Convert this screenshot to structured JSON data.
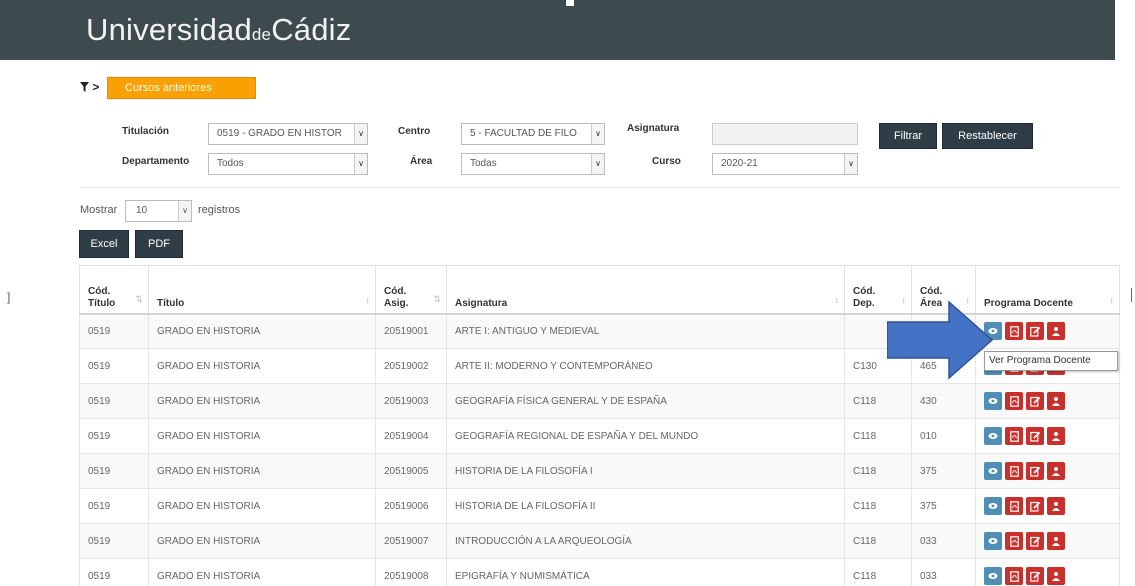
{
  "header": {
    "logo_left": "Universidad",
    "logo_de": "de",
    "logo_right": "Cádiz"
  },
  "filters": {
    "toggle_icon": "filter-icon",
    "arrow": ">",
    "cursos_anteriores": "Cursos anteriores",
    "titulacion_label": "Titulación",
    "titulacion_value": "0519 - GRADO EN HISTOR",
    "centro_label": "Centro",
    "centro_value": "5 - FACULTAD DE FILO",
    "asignatura_label": "Asignatura",
    "asignatura_value": "",
    "departamento_label": "Departamento",
    "departamento_value": "Todos",
    "area_label": "Área",
    "area_value": "Todas",
    "curso_label": "Curso",
    "curso_value": "2020-21",
    "filtrar": "Filtrar",
    "restablecer": "Restablecer"
  },
  "controls": {
    "mostrar": "Mostrar",
    "page_length": "10",
    "registros": "registros",
    "excel": "Excel",
    "pdf": "PDF"
  },
  "table": {
    "columns": [
      {
        "l1": "Cód.",
        "l2": "Título"
      },
      {
        "l1": "",
        "l2": "Título"
      },
      {
        "l1": "Cód.",
        "l2": "Asig."
      },
      {
        "l1": "",
        "l2": "Asignatura"
      },
      {
        "l1": "Cód.",
        "l2": "Dep."
      },
      {
        "l1": "Cód.",
        "l2": "Área"
      },
      {
        "l1": "",
        "l2": "Programa Docente"
      }
    ],
    "rows": [
      {
        "cod_titulo": "0519",
        "titulo": "GRADO EN HISTORIA",
        "cod_asig": "20519001",
        "asignatura": "ARTE I: ANTIGUO Y MEDIEVAL",
        "cod_dep": "",
        "cod_area": ""
      },
      {
        "cod_titulo": "0519",
        "titulo": "GRADO EN HISTORIA",
        "cod_asig": "20519002",
        "asignatura": "ARTE II: MODERNO Y CONTEMPORÁNEO",
        "cod_dep": "C130",
        "cod_area": "465"
      },
      {
        "cod_titulo": "0519",
        "titulo": "GRADO EN HISTORIA",
        "cod_asig": "20519003",
        "asignatura": "GEOGRAFÍA FÍSICA GENERAL Y DE ESPAÑA",
        "cod_dep": "C118",
        "cod_area": "430"
      },
      {
        "cod_titulo": "0519",
        "titulo": "GRADO EN HISTORIA",
        "cod_asig": "20519004",
        "asignatura": "GEOGRAFÍA REGIONAL DE ESPAÑA Y DEL MUNDO",
        "cod_dep": "C118",
        "cod_area": "010"
      },
      {
        "cod_titulo": "0519",
        "titulo": "GRADO EN HISTORIA",
        "cod_asig": "20519005",
        "asignatura": "HISTORIA DE LA FILOSOFÍA I",
        "cod_dep": "C118",
        "cod_area": "375"
      },
      {
        "cod_titulo": "0519",
        "titulo": "GRADO EN HISTORIA",
        "cod_asig": "20519006",
        "asignatura": "HISTORIA DE LA FILOSOFÍA II",
        "cod_dep": "C118",
        "cod_area": "375"
      },
      {
        "cod_titulo": "0519",
        "titulo": "GRADO EN HISTORIA",
        "cod_asig": "20519007",
        "asignatura": "INTRODUCCIÓN A LA ARQUEOLOGÍA",
        "cod_dep": "C118",
        "cod_area": "033"
      },
      {
        "cod_titulo": "0519",
        "titulo": "GRADO EN HISTORIA",
        "cod_asig": "20519008",
        "asignatura": "EPIGRAFÍA Y NUMISMÁTICA",
        "cod_dep": "C118",
        "cod_area": "033"
      }
    ],
    "action_icons": [
      "eye-icon",
      "pdf-icon",
      "edit-icon",
      "user-icon"
    ]
  },
  "tooltip": "Ver Programa Docente",
  "colors": {
    "header_bg": "#3d4a4e",
    "accent_orange": "#f9a100",
    "dark_button": "#2f3e46",
    "view_button": "#4f8fb5",
    "red_button": "#c9302c",
    "arrow_blue": "#4472c4"
  }
}
